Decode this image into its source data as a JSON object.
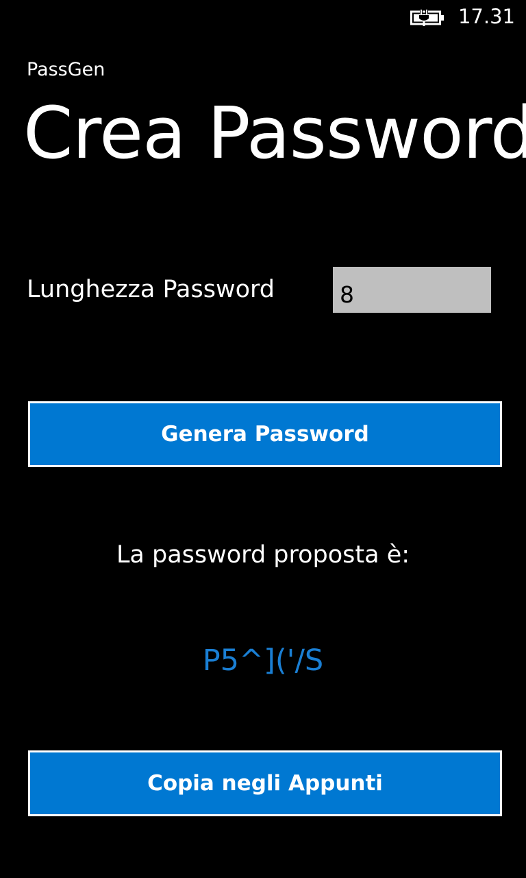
{
  "status_bar": {
    "time": "17.31",
    "battery_icon": "battery-charging-icon"
  },
  "app": {
    "name": "PassGen",
    "page_title": "Crea Password"
  },
  "form": {
    "length_label": "Lunghezza Password",
    "length_value": "8"
  },
  "actions": {
    "generate_label": "Genera Password",
    "copy_label": "Copia negli Appunti"
  },
  "result": {
    "label": "La password proposta è:",
    "password": "P5^]('/S"
  },
  "colors": {
    "background": "#000000",
    "accent": "#0078d2",
    "input_background": "#bfbfbf",
    "password_text": "#1a7fd4"
  }
}
